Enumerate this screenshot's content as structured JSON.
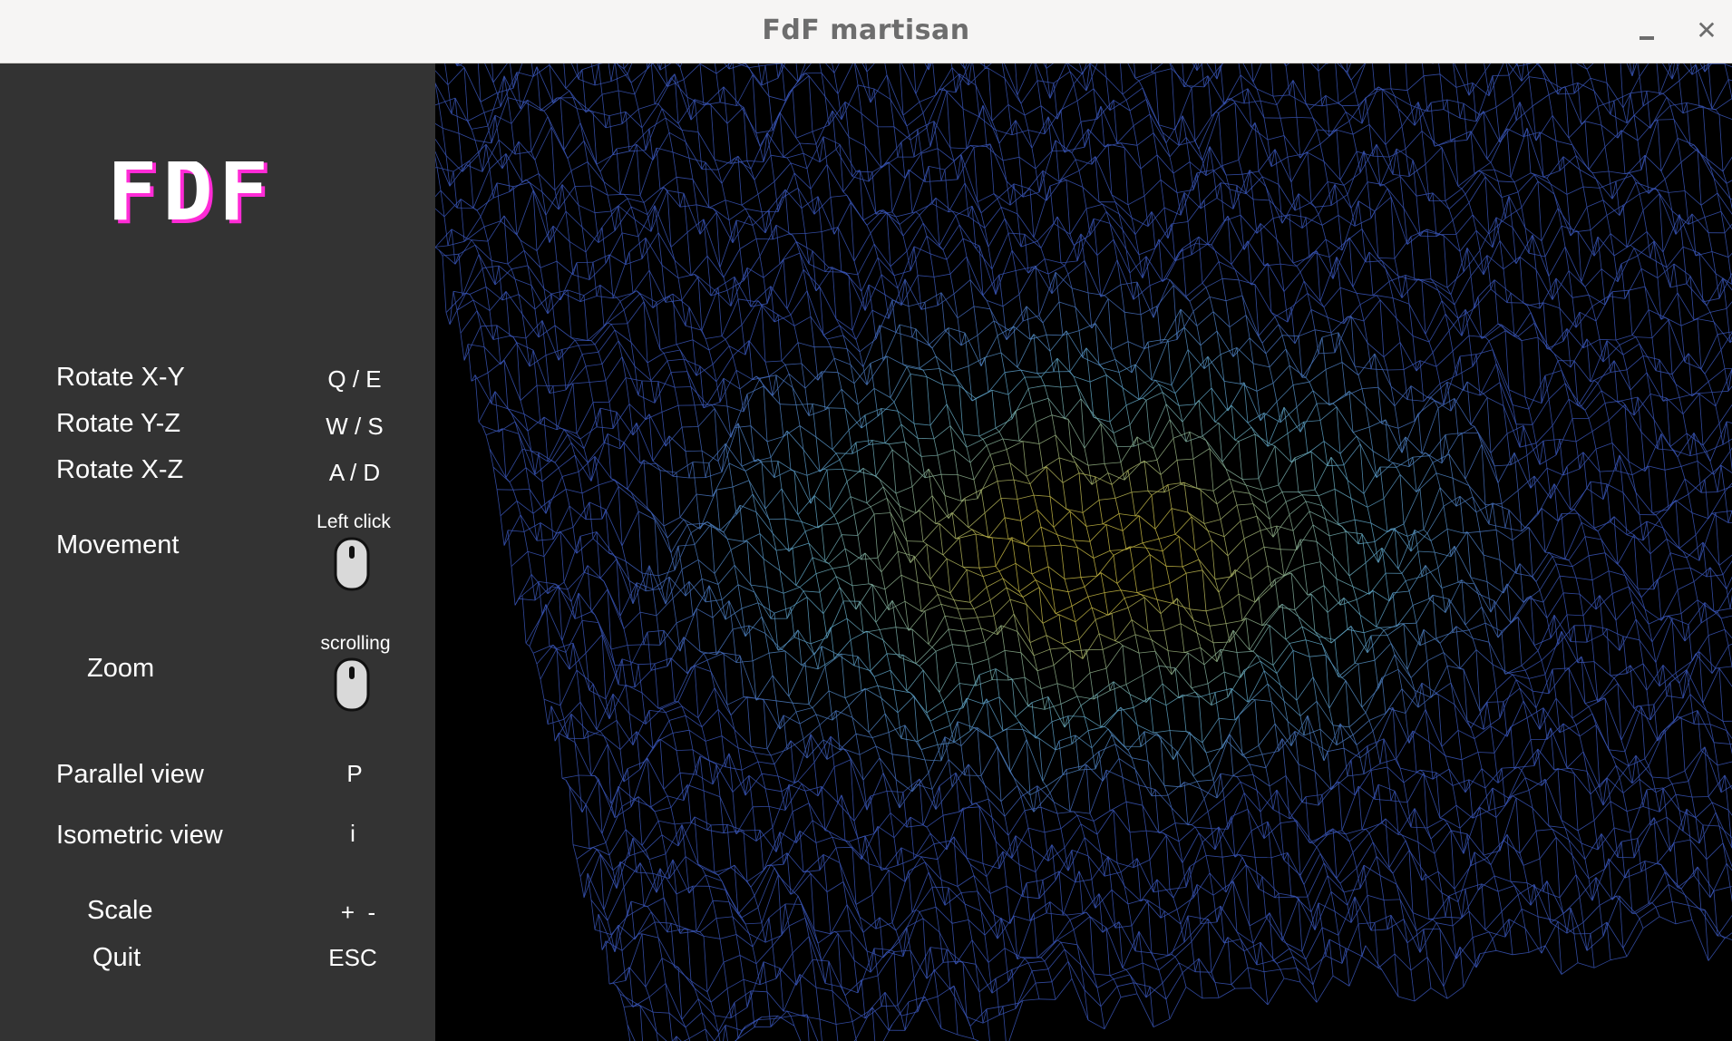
{
  "window": {
    "title": "FdF martisan",
    "minimize_icon": "minimize-icon",
    "close_label": "✕"
  },
  "sidebar": {
    "logo_text": "FDF",
    "controls": [
      {
        "label": "Rotate X-Y",
        "key": "Q / E"
      },
      {
        "label": "Rotate Y-Z",
        "key": "W / S"
      },
      {
        "label": "Rotate X-Z",
        "key": "A / D"
      },
      {
        "label": "Movement",
        "key_caption": "Left click",
        "icon": "mouse-icon"
      },
      {
        "label": "Zoom",
        "key_caption": "scrolling",
        "icon": "mouse-icon"
      },
      {
        "label": "Parallel view",
        "key": "P"
      },
      {
        "label": "Isometric view",
        "key": "i"
      },
      {
        "label": "Scale",
        "key": "+  -"
      },
      {
        "label": "Quit",
        "key": "ESC"
      }
    ]
  },
  "viewport": {
    "content": "wireframe-terrain",
    "colors": {
      "low": "#3a56b8",
      "mid": "#5fa6c4",
      "high": "#c9bb43",
      "background": "#000000"
    }
  }
}
